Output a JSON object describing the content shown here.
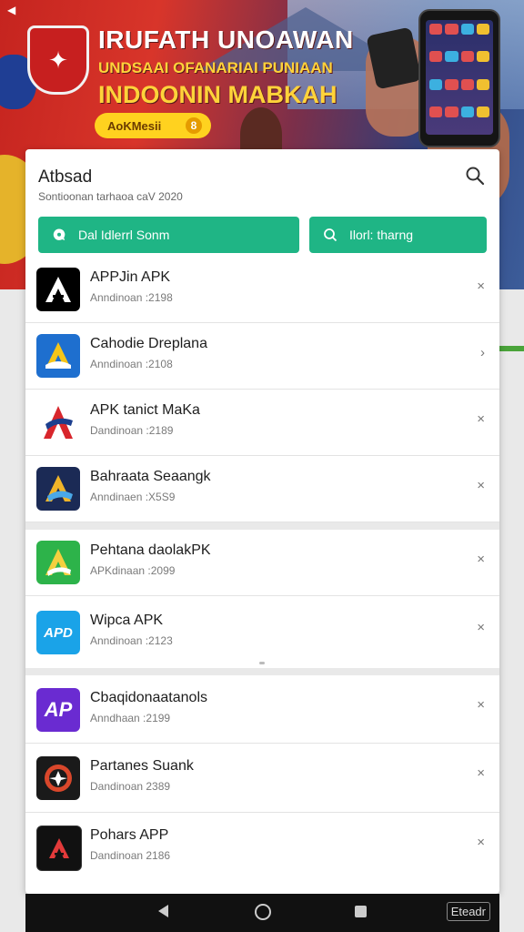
{
  "banner": {
    "line1": "IRUFATH UNOAWAN",
    "line2": "UNDSAAI OFANARIAI PUNIAAN",
    "line3": "INDOONIN MABKAH",
    "promo_label": "AoKMesii",
    "promo_coin": "8"
  },
  "card": {
    "title": "Atbsad",
    "subtitle": "Sontioonan tarhaoa caV 2020",
    "button_primary": "Dal Idlerrl Sonm",
    "button_secondary": "Ilorl: tharng"
  },
  "apps": [
    {
      "name": "APPJin APK",
      "meta": "Anndinoan :2198",
      "action": "×",
      "icon": "a-black-icon",
      "color": "#000000",
      "glyph": "A"
    },
    {
      "name": "Cahodie Dreplana",
      "meta": "Anndinoan :2108",
      "action": "›",
      "icon": "a-blue-icon",
      "color": "#1e6fcf",
      "glyph": "A"
    },
    {
      "name": "APK tanict MaKa",
      "meta": "Dandinoan :2189",
      "action": "×",
      "icon": "a-red-icon",
      "color": "#ffffff",
      "glyph": "A"
    },
    {
      "name": "Bahraata Seaangk",
      "meta": "Anndinaen :X5S9",
      "action": "×",
      "icon": "a-navy-icon",
      "color": "#1b2a55",
      "glyph": "A"
    },
    {
      "name": "Pehtana daolakPK",
      "meta": "APKdinaan :2099",
      "action": "×",
      "icon": "a-green-icon",
      "color": "#2db34a",
      "glyph": "A"
    },
    {
      "name": "Wipca APK",
      "meta": "Anndinoan :2123",
      "action": "×",
      "icon": "apd-blue-icon",
      "color": "#1aa3e8",
      "glyph": "APD"
    },
    {
      "name": "Cbaqidonaatanols",
      "meta": "Anndhaan :2199",
      "action": "×",
      "icon": "ap-purple-icon",
      "color": "#6a2bd1",
      "glyph": "AP"
    },
    {
      "name": "Partanes Suank",
      "meta": "Dandinoan 2389",
      "action": "×",
      "icon": "badge-dark-icon",
      "color": "#1a1a1a",
      "glyph": "✪"
    },
    {
      "name": "Pohars APP",
      "meta": "Dandinoan 2186",
      "action": "×",
      "icon": "a-dark-icon",
      "color": "#111111",
      "glyph": "A"
    }
  ],
  "navbar": {
    "extra_label": "Eteadr"
  }
}
